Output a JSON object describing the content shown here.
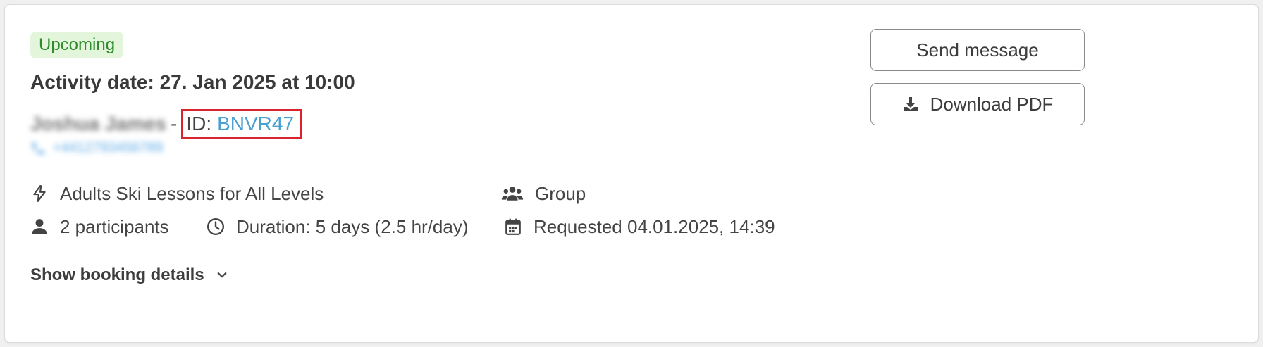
{
  "booking": {
    "status_badge": "Upcoming",
    "activity_date": "Activity date: 27. Jan 2025 at 10:00",
    "customer_name": "Joshua James",
    "separator": "-",
    "id_label": "ID:",
    "id_value": "BNVR47",
    "phone": "+4412793456789"
  },
  "info": {
    "activity": "Adults Ski Lessons for All Levels",
    "type": "Group",
    "participants": "2 participants",
    "duration": "Duration: 5 days (2.5 hr/day)",
    "requested": "Requested 04.01.2025, 14:39"
  },
  "actions": {
    "send_message": "Send message",
    "download_pdf": "Download PDF",
    "show_details": "Show booking details"
  },
  "colors": {
    "badge_bg": "#e3f6dc",
    "badge_text": "#2e8b2e",
    "link": "#4a9fd1",
    "highlight_border": "#d9232d"
  }
}
